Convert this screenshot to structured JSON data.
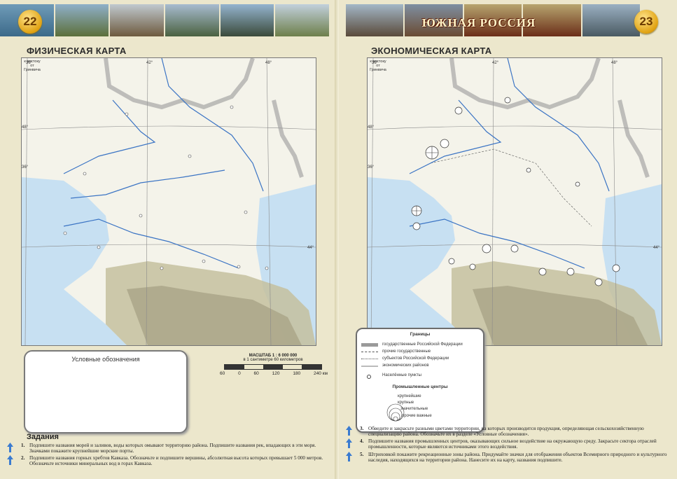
{
  "left_page": {
    "page_number": "22",
    "map_title": "ФИЗИЧЕСКАЯ КАРТА",
    "greenwich_note": "к востоку от Гринвича",
    "lon_labels": [
      "36°",
      "42°",
      "48°"
    ],
    "lat_labels": [
      "48°",
      "36°",
      "44°"
    ],
    "legend_title": "Условные обозначения",
    "scale_title": "МАСШТАБ 1 : 6 000 000",
    "scale_sub": "в 1 сантиметре 60 километров",
    "scale_ticks": [
      "60",
      "0",
      "60",
      "120",
      "180",
      "240 км"
    ],
    "tasks_title": "Задания",
    "tasks": [
      {
        "num": "1.",
        "text": "Подпишите названия морей и заливов, воды которых омывают территорию района. Подпишите названия рек, впадающих в эти моря. Значками покажите крупнейшие морские порты."
      },
      {
        "num": "2.",
        "text": "Подпишите названия горных хребтов Кавказа. Обозначьте и подпишите вершины, абсолютная высота которых превышает 5 000 метров. Обозначьте источники минеральных вод в горах Кавказа."
      }
    ]
  },
  "right_page": {
    "page_number": "23",
    "banner": "ЮЖНАЯ РОССИЯ",
    "map_title": "ЭКОНОМИЧЕСКАЯ КАРТА",
    "greenwich_note": "к востоку от Гринвича",
    "lon_labels": [
      "36°",
      "42°",
      "48°"
    ],
    "lat_labels": [
      "48°",
      "36°",
      "44°"
    ],
    "legend": {
      "borders_title": "Границы",
      "borders": [
        "государственные Российской Федерации",
        "прочие государственные",
        "субъектов Российской Федерации",
        "экономических районов"
      ],
      "settlements": "Населённые пункты",
      "industrial_title": "Промышленные центры",
      "industrial": [
        "крупнейшие",
        "крупные",
        "значительные",
        "прочие важные"
      ]
    },
    "tasks": [
      {
        "num": "3.",
        "text": "Обведите и закрасьте разными цветами территории, на которых производится продукция, определяющая сельскохозяйственную специализацию района. Обозначьте их в разделе «Условные обозначения»."
      },
      {
        "num": "4.",
        "text": "Подпишите названия промышленных центров, оказывающих сильное воздействие на окружающую среду. Закрасьте сектора отраслей промышленности, которые являются источниками этого воздействия."
      },
      {
        "num": "5.",
        "text": "Штриховкой покажите рекреационные зоны района. Придумайте значки для отображения объектов Всемирного природного и культурного наследия, находящихся на территории района. Нанесите их на карту, названия подпишите."
      }
    ]
  },
  "colors": {
    "sea": "#c7e0f2",
    "mountains": "#b9b59a",
    "border_gray": "#9a9a9a",
    "river": "#3b74c4",
    "page_bg": "#ece7cc"
  }
}
